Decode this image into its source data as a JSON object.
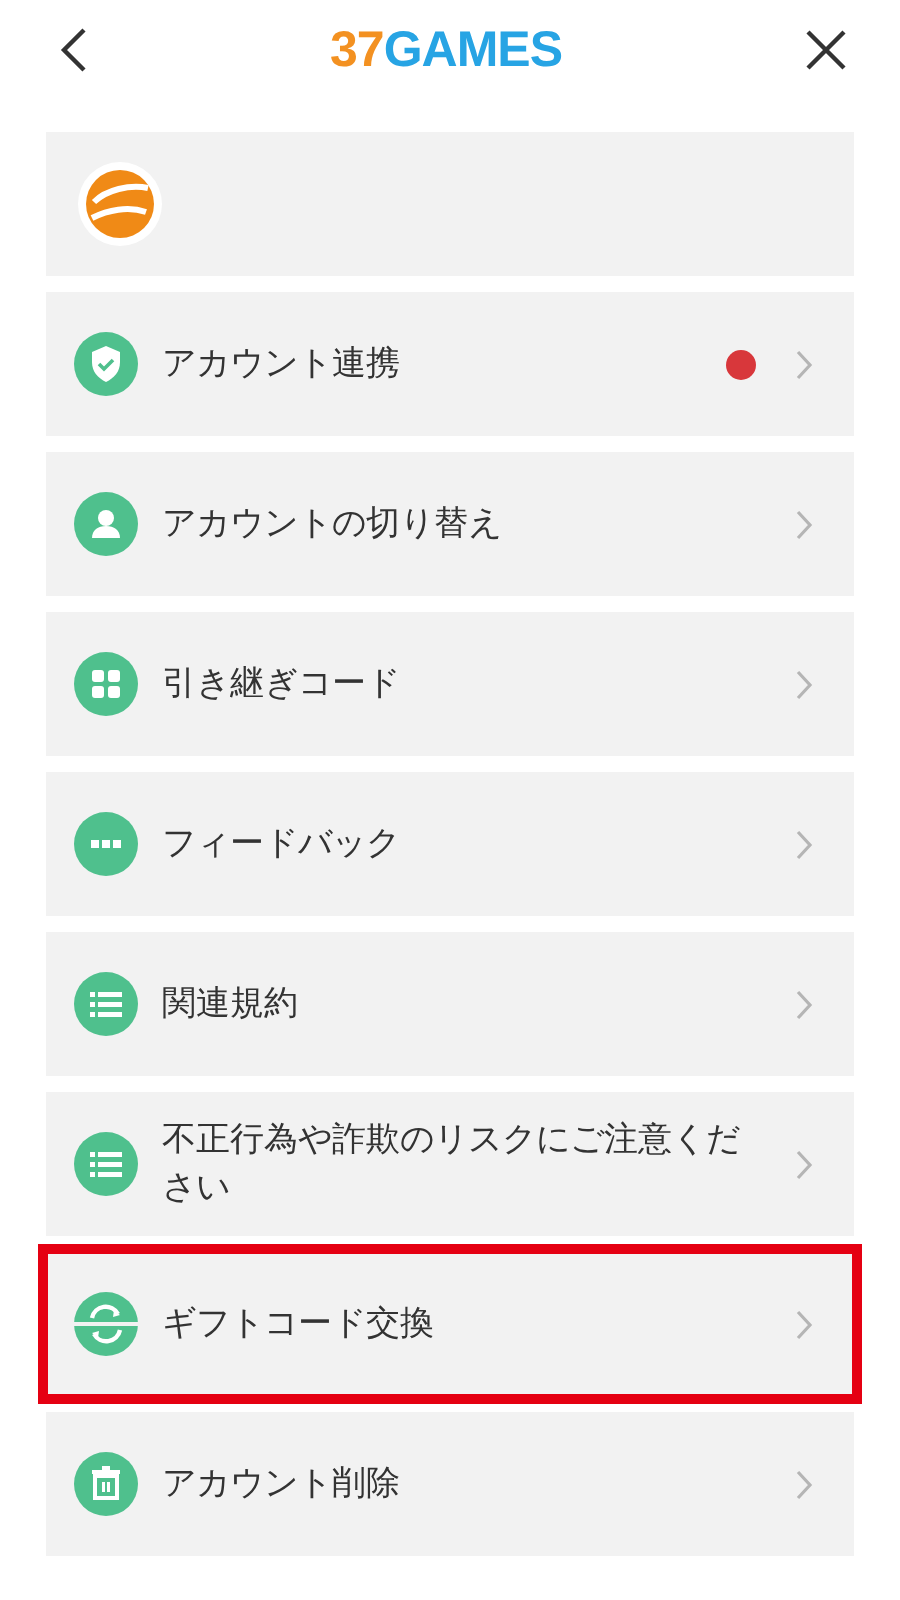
{
  "header": {
    "logo": {
      "number": "37",
      "word": "GAMES"
    }
  },
  "profile": {
    "avatar": true
  },
  "menu": [
    {
      "kind": "shield",
      "label": "アカウント連携",
      "badge": true,
      "highlighted": false
    },
    {
      "kind": "person",
      "label": "アカウントの切り替え",
      "badge": false,
      "highlighted": false
    },
    {
      "kind": "grid",
      "label": "引き継ぎコード",
      "badge": false,
      "highlighted": false
    },
    {
      "kind": "dots",
      "label": "フィードバック",
      "badge": false,
      "highlighted": false
    },
    {
      "kind": "list",
      "label": "関連規約",
      "badge": false,
      "highlighted": false
    },
    {
      "kind": "list",
      "label": "不正行為や詐欺のリスクにご注意ください",
      "badge": false,
      "highlighted": false
    },
    {
      "kind": "exchange",
      "label": "ギフトコード交換",
      "badge": false,
      "highlighted": true
    },
    {
      "kind": "trash",
      "label": "アカウント削除",
      "badge": false,
      "highlighted": false
    }
  ]
}
